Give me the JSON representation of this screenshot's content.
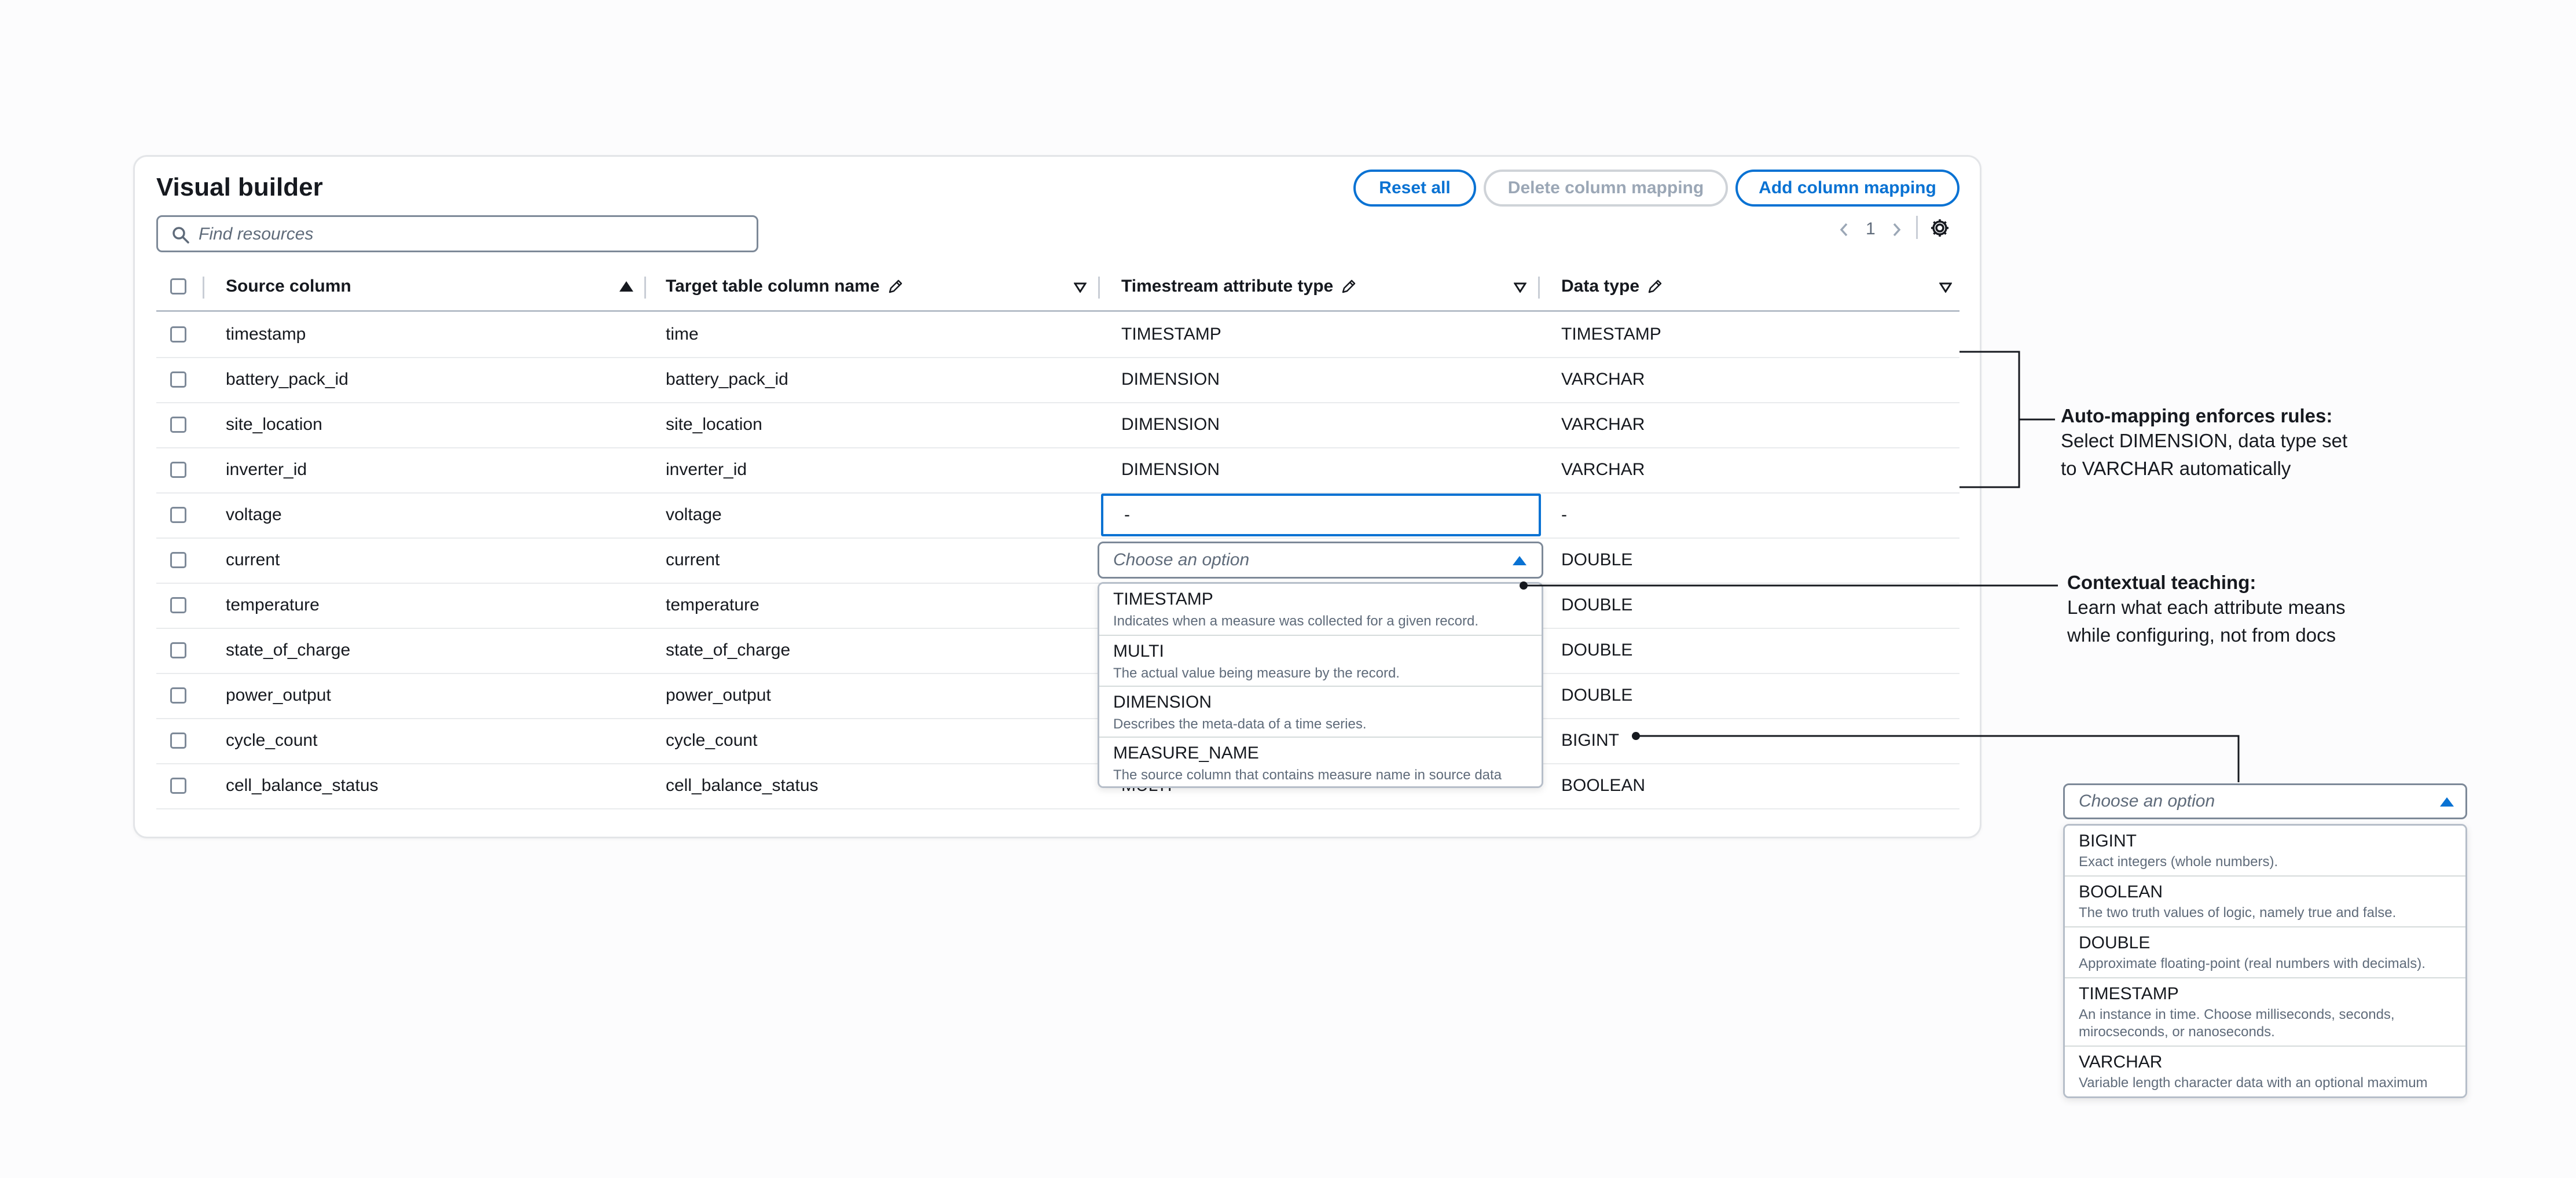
{
  "builder": {
    "title": "Visual builder",
    "reset_label": "Reset all",
    "delete_label": "Delete column mapping",
    "add_label": "Add column mapping",
    "search_placeholder": "Find resources",
    "page_number": "1"
  },
  "table": {
    "headers": {
      "source": "Source column",
      "target": "Target table column name",
      "attr": "Timestream attribute type",
      "dtype": "Data type"
    },
    "rows": [
      {
        "source": "timestamp",
        "target": "time",
        "attr": "TIMESTAMP",
        "dtype": "TIMESTAMP"
      },
      {
        "source": "battery_pack_id",
        "target": "battery_pack_id",
        "attr": "DIMENSION",
        "dtype": "VARCHAR"
      },
      {
        "source": "site_location",
        "target": "site_location",
        "attr": "DIMENSION",
        "dtype": "VARCHAR"
      },
      {
        "source": "inverter_id",
        "target": "inverter_id",
        "attr": "DIMENSION",
        "dtype": "VARCHAR"
      },
      {
        "source": "voltage",
        "target": "voltage",
        "attr": "-",
        "dtype": "-"
      },
      {
        "source": "current",
        "target": "current",
        "attr": "",
        "dtype": "DOUBLE"
      },
      {
        "source": "temperature",
        "target": "temperature",
        "attr": "",
        "dtype": "DOUBLE"
      },
      {
        "source": "state_of_charge",
        "target": "state_of_charge",
        "attr": "",
        "dtype": "DOUBLE"
      },
      {
        "source": "power_output",
        "target": "power_output",
        "attr": "",
        "dtype": "DOUBLE"
      },
      {
        "source": "cycle_count",
        "target": "cycle_count",
        "attr": "",
        "dtype": "BIGINT"
      },
      {
        "source": "cell_balance_status",
        "target": "cell_balance_status",
        "attr": "MULTI",
        "dtype": "BOOLEAN"
      }
    ]
  },
  "attr_select": {
    "placeholder": "Choose an option",
    "options": [
      {
        "label": "TIMESTAMP",
        "desc": "Indicates when a measure was collected for a given record."
      },
      {
        "label": "MULTI",
        "desc": "The actual value being measure by the record."
      },
      {
        "label": "DIMENSION",
        "desc": "Describes the meta-data of a time series."
      },
      {
        "label": "MEASURE_NAME",
        "desc": "The source column that contains measure name in source data"
      }
    ]
  },
  "dtype_select": {
    "placeholder": "Choose an option",
    "options": [
      {
        "label": "BIGINT",
        "desc": "Exact integers (whole numbers)."
      },
      {
        "label": "BOOLEAN",
        "desc": "The two truth values of logic, namely true and false."
      },
      {
        "label": "DOUBLE",
        "desc": "Approximate floating-point (real numbers with decimals)."
      },
      {
        "label": "TIMESTAMP",
        "desc_line1": "An instance in time. Choose milliseconds, seconds,",
        "desc_line2": "mirocseconds, or nanoseconds."
      },
      {
        "label": "VARCHAR",
        "desc": "Variable length character data with an optional maximum"
      }
    ]
  },
  "annotations": {
    "auto": {
      "title": "Auto-mapping enforces rules:",
      "line1": "Select DIMENSION, data type set",
      "line2": "to VARCHAR automatically"
    },
    "context": {
      "title": "Contextual teaching:",
      "line1": "Learn what each attribute means",
      "line2": "while configuring, not from docs"
    }
  },
  "colors": {
    "accent": "#0972d3",
    "text": "#16191f",
    "muted": "#5f6b7a",
    "disabled": "#9ba7b6"
  }
}
